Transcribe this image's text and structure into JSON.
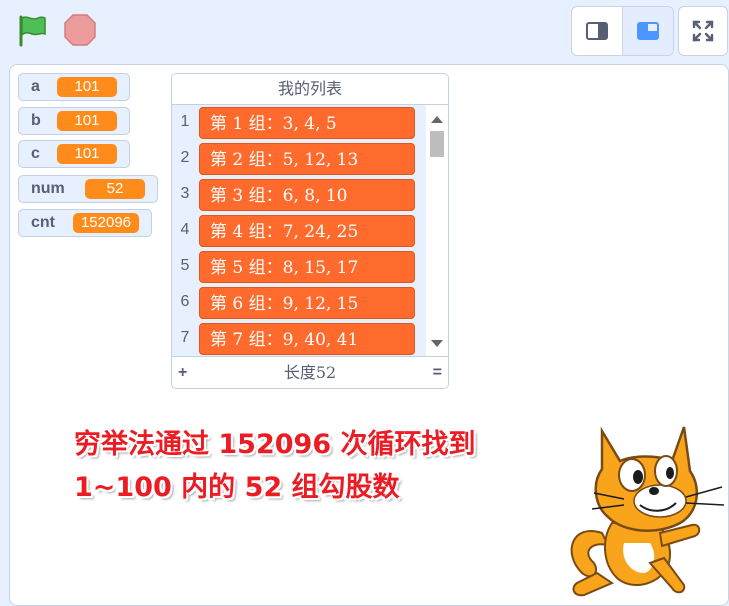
{
  "toolbar": {
    "green_flag_icon": "green-flag-icon",
    "stop_icon": "stop-sign-icon",
    "layout_buttons": [
      "small-stage-icon",
      "normal-stage-icon"
    ],
    "fullscreen_icon": "fullscreen-icon"
  },
  "variables": [
    {
      "name": "a",
      "value": "101"
    },
    {
      "name": "b",
      "value": "101"
    },
    {
      "name": "c",
      "value": "101"
    },
    {
      "name": "num",
      "value": "52"
    },
    {
      "name": "cnt",
      "value": "152096"
    }
  ],
  "list": {
    "title": "我的列表",
    "rows": [
      {
        "index": "1",
        "value": "第 1 组：3, 4, 5"
      },
      {
        "index": "2",
        "value": "第 2 组：5, 12, 13"
      },
      {
        "index": "3",
        "value": "第 3 组：6, 8, 10"
      },
      {
        "index": "4",
        "value": "第 4 组：7, 24, 25"
      },
      {
        "index": "5",
        "value": "第 5 组：8, 15, 17"
      },
      {
        "index": "6",
        "value": "第 6 组：9, 12, 15"
      },
      {
        "index": "7",
        "value": "第 7 组：9, 40, 41"
      }
    ],
    "add_label": "+",
    "length_label": "长度52",
    "resize_label": "="
  },
  "caption": {
    "line1": "穷举法通过 152096 次循环找到",
    "line2": "1~100 内的 52 组勾股数"
  },
  "colors": {
    "accent": "#ff8c1a",
    "list_item": "#ff6a2d",
    "caption": "#ec1c24",
    "stage_bg": "#e6f0ff"
  }
}
